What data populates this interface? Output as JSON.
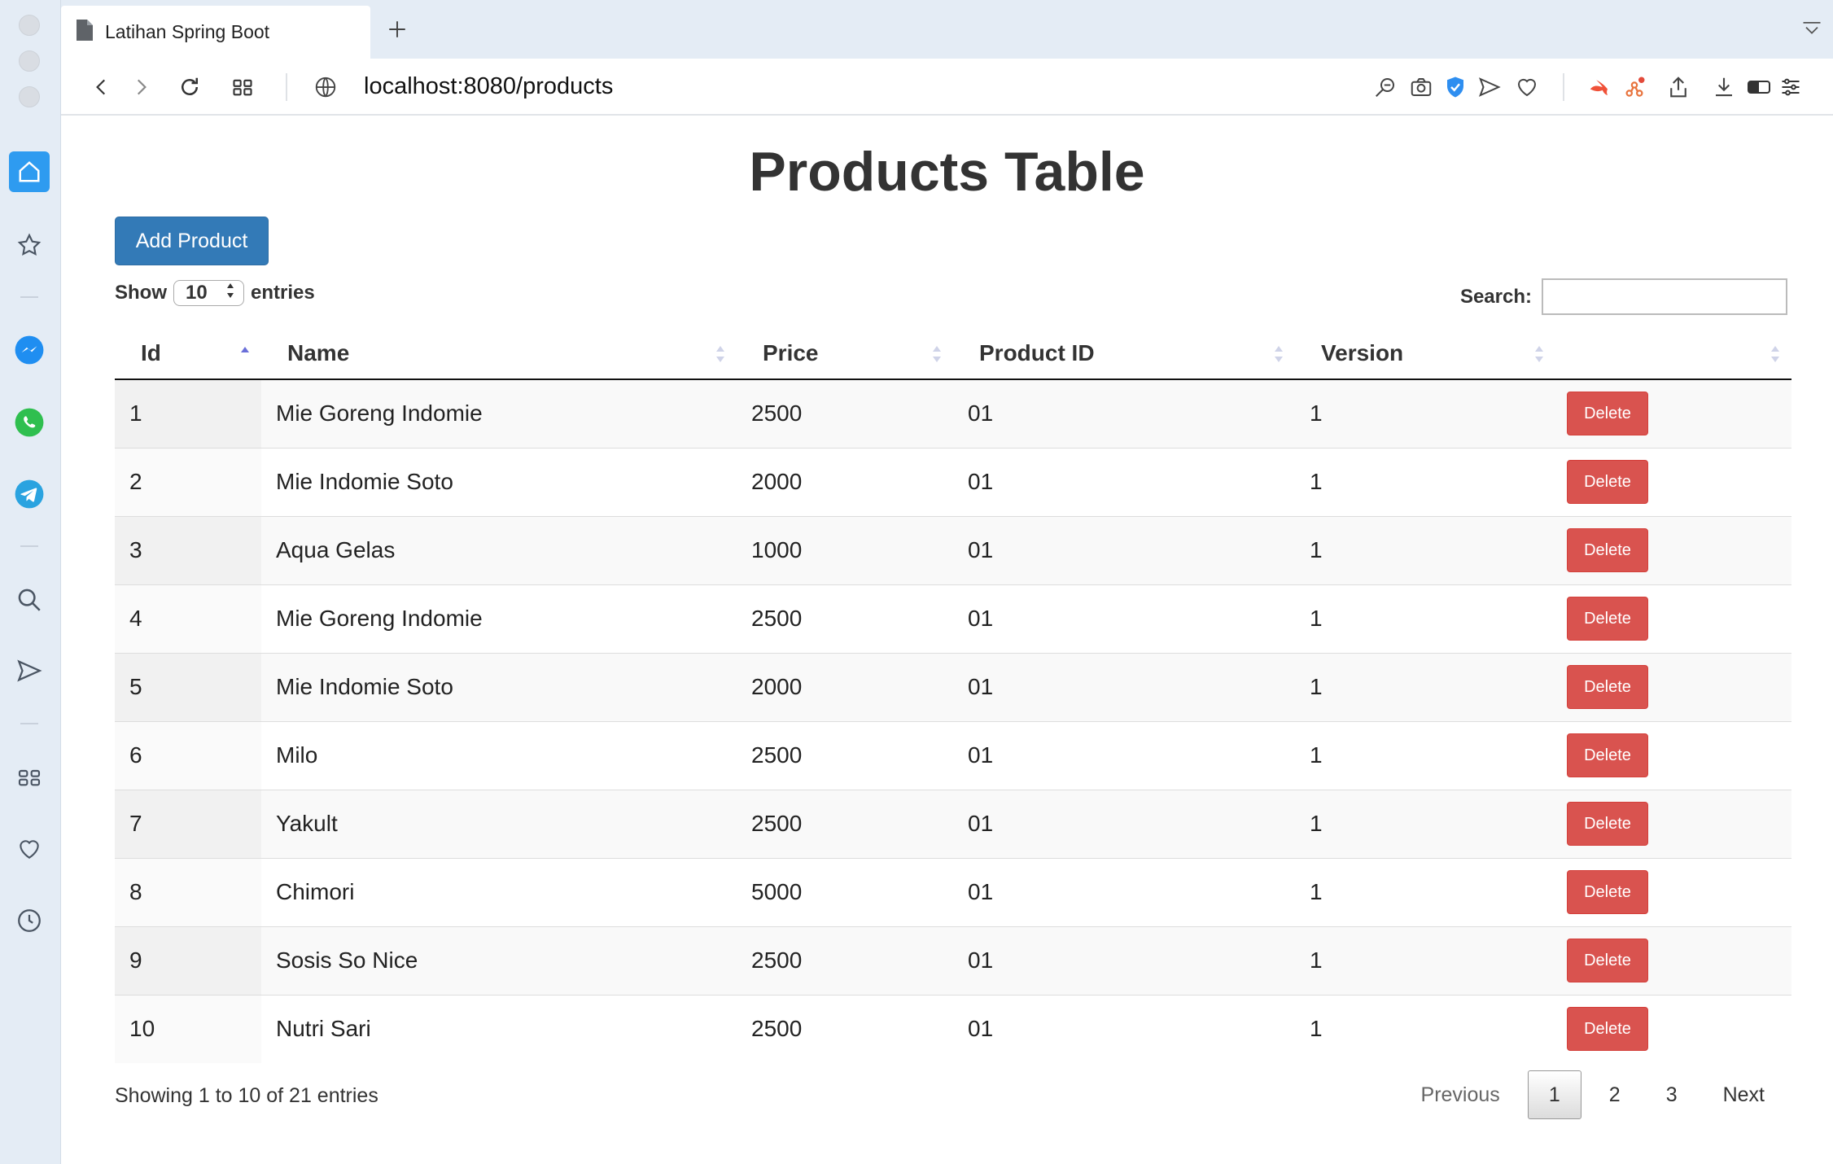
{
  "browser": {
    "tab_title": "Latihan Spring Boot",
    "url": "localhost:8080/products"
  },
  "page": {
    "title": "Products Table",
    "add_button": "Add Product",
    "length": {
      "show_label": "Show",
      "value": "10",
      "entries_label": "entries"
    },
    "search_label": "Search:",
    "search_value": ""
  },
  "table": {
    "columns": [
      "Id",
      "Name",
      "Price",
      "Product ID",
      "Version",
      ""
    ],
    "delete_label": "Delete",
    "rows": [
      {
        "id": "1",
        "name": "Mie Goreng Indomie",
        "price": "2500",
        "product_id": "01",
        "version": "1"
      },
      {
        "id": "2",
        "name": "Mie Indomie Soto",
        "price": "2000",
        "product_id": "01",
        "version": "1"
      },
      {
        "id": "3",
        "name": "Aqua Gelas",
        "price": "1000",
        "product_id": "01",
        "version": "1"
      },
      {
        "id": "4",
        "name": "Mie Goreng Indomie",
        "price": "2500",
        "product_id": "01",
        "version": "1"
      },
      {
        "id": "5",
        "name": "Mie Indomie Soto",
        "price": "2000",
        "product_id": "01",
        "version": "1"
      },
      {
        "id": "6",
        "name": "Milo",
        "price": "2500",
        "product_id": "01",
        "version": "1"
      },
      {
        "id": "7",
        "name": "Yakult",
        "price": "2500",
        "product_id": "01",
        "version": "1"
      },
      {
        "id": "8",
        "name": "Chimori",
        "price": "5000",
        "product_id": "01",
        "version": "1"
      },
      {
        "id": "9",
        "name": "Sosis So Nice",
        "price": "2500",
        "product_id": "01",
        "version": "1"
      },
      {
        "id": "10",
        "name": "Nutri Sari",
        "price": "2500",
        "product_id": "01",
        "version": "1"
      }
    ]
  },
  "footer": {
    "info": "Showing 1 to 10 of 21 entries",
    "previous": "Previous",
    "pages": [
      "1",
      "2",
      "3"
    ],
    "current_page": "1",
    "next": "Next"
  },
  "colors": {
    "primary": "#337ab7",
    "danger": "#d9534f",
    "sidebar_active": "#2e9bf0"
  }
}
